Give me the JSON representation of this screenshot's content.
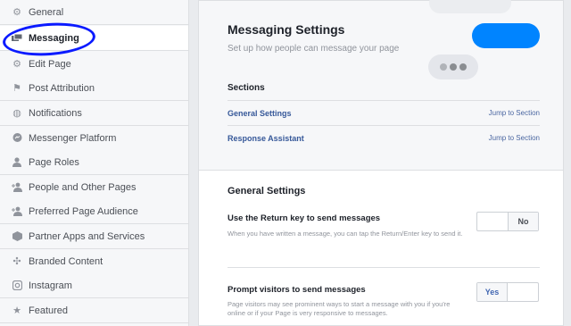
{
  "sidebar": {
    "items": [
      {
        "label": "General",
        "icon": "gear-icon",
        "glyph": "⚙"
      },
      {
        "label": "Messaging",
        "icon": "messaging-icon",
        "glyph": "▪"
      },
      {
        "label": "Edit Page",
        "icon": "gear-icon",
        "glyph": "⚙"
      },
      {
        "label": "Post Attribution",
        "icon": "flag-icon",
        "glyph": "⚑"
      },
      {
        "label": "Notifications",
        "icon": "globe-icon",
        "glyph": "◍"
      },
      {
        "label": "Messenger Platform",
        "icon": "messenger-icon",
        "glyph": "●"
      },
      {
        "label": "Page Roles",
        "icon": "person-icon",
        "glyph": "♟"
      },
      {
        "label": "People and Other Pages",
        "icon": "add-person-icon",
        "glyph": "♟"
      },
      {
        "label": "Preferred Page Audience",
        "icon": "add-person-icon",
        "glyph": "♟"
      },
      {
        "label": "Partner Apps and Services",
        "icon": "box-icon",
        "glyph": "▣"
      },
      {
        "label": "Branded Content",
        "icon": "handshake-icon",
        "glyph": "✣"
      },
      {
        "label": "Instagram",
        "icon": "instagram-icon",
        "glyph": "◎"
      },
      {
        "label": "Featured",
        "icon": "star-icon",
        "glyph": "★"
      }
    ],
    "active_index": 1
  },
  "main": {
    "title": "Messaging Settings",
    "subtitle": "Set up how people can message your page",
    "sections_label": "Sections",
    "sections": [
      {
        "name": "General Settings",
        "jump": "Jump to Section"
      },
      {
        "name": "Response Assistant",
        "jump": "Jump to Section"
      }
    ],
    "general_settings_title": "General Settings",
    "options": [
      {
        "title": "Use the Return key to send messages",
        "description": "When you have written a message, you can tap the Return/Enter key to send it.",
        "yes_label": "",
        "no_label": "No",
        "selected": "No"
      },
      {
        "title": "Prompt visitors to send messages",
        "description": "Page visitors may see prominent ways to start a message with you if you're online or if your Page is very responsive to messages.",
        "yes_label": "Yes",
        "no_label": "",
        "selected": "Yes"
      }
    ]
  },
  "colors": {
    "accent": "#4267b2",
    "messenger_blue": "#0084ff",
    "annotation": "#0a1aff"
  }
}
